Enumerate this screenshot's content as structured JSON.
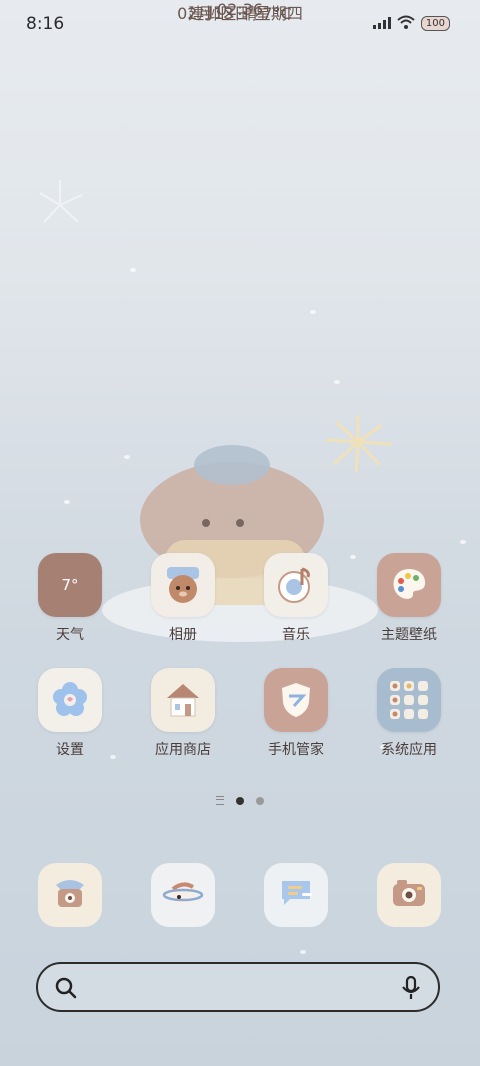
{
  "status_bar": {
    "time": "8:16",
    "battery": "100"
  },
  "clock": {
    "time": "02:36",
    "date": "02月13日 星期四",
    "location_weather": "建邺区 晴 7°C"
  },
  "apps_row1": [
    {
      "label": "天气",
      "icon": "weather-icon",
      "temp": "7°"
    },
    {
      "label": "相册",
      "icon": "gallery-icon"
    },
    {
      "label": "音乐",
      "icon": "music-icon"
    },
    {
      "label": "主题壁纸",
      "icon": "palette-icon"
    }
  ],
  "apps_row2": [
    {
      "label": "设置",
      "icon": "flower-settings-icon"
    },
    {
      "label": "应用商店",
      "icon": "house-store-icon"
    },
    {
      "label": "手机管家",
      "icon": "shield-icon"
    },
    {
      "label": "系统应用",
      "icon": "folder-grid-icon"
    }
  ],
  "dock": [
    {
      "name": "phone-icon"
    },
    {
      "name": "browser-planet-icon"
    },
    {
      "name": "messages-icon"
    },
    {
      "name": "camera-icon"
    }
  ],
  "pager": {
    "pages": 2,
    "active": 1
  },
  "colors": {
    "accent_brown": "#b79183",
    "text": "#4a3d3a",
    "clock": "#6e5a55"
  }
}
